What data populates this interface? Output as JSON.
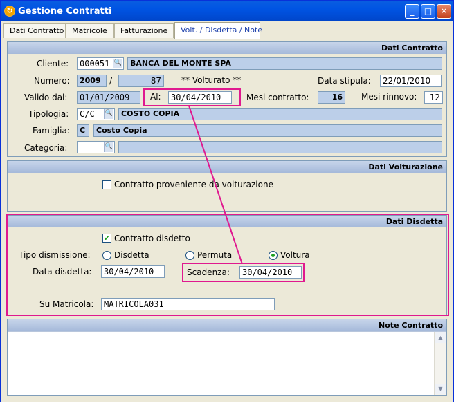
{
  "window": {
    "title": "Gestione Contratti",
    "minimize_glyph": "_",
    "maximize_glyph": "□",
    "close_glyph": "✕"
  },
  "tabs": [
    {
      "label": "Dati Contratto"
    },
    {
      "label": "Matricole"
    },
    {
      "label": "Fatturazione"
    },
    {
      "label": "Volt. / Disdetta / Note"
    }
  ],
  "dati_contratto": {
    "header": "Dati Contratto",
    "cliente_label": "Cliente:",
    "cliente_code": "000051",
    "cliente_name": "BANCA DEL MONTE SPA",
    "numero_label": "Numero:",
    "numero_year": "2009",
    "numero_sep": "/",
    "numero_num": "87",
    "volturato_text": "**  Volturato  **",
    "data_stipula_label": "Data stipula:",
    "data_stipula": "22/01/2010",
    "valido_dal_label": "Valido dal:",
    "valido_dal": "01/01/2009",
    "al_label": "Al:",
    "al_value": "30/04/2010",
    "mesi_contratto_label": "Mesi contratto:",
    "mesi_contratto": "16",
    "mesi_rinnovo_label": "Mesi rinnovo:",
    "mesi_rinnovo": "12",
    "tipologia_label": "Tipologia:",
    "tipologia_code": "C/C",
    "tipologia_desc": "COSTO COPIA",
    "famiglia_label": "Famiglia:",
    "famiglia_code": "C",
    "famiglia_desc": "Costo Copia",
    "categoria_label": "Categoria:",
    "categoria_code": "",
    "categoria_desc": ""
  },
  "dati_volturazione": {
    "header": "Dati Volturazione",
    "proveniente_label": "Contratto proveniente da volturazione",
    "proveniente_checked": false
  },
  "dati_disdetta": {
    "header": "Dati Disdetta",
    "disdetto_label": "Contratto disdetto",
    "disdetto_checked": true,
    "tipo_label": "Tipo dismissione:",
    "options": [
      "Disdetta",
      "Permuta",
      "Voltura"
    ],
    "selected": "Voltura",
    "data_disdetta_label": "Data disdetta:",
    "data_disdetta": "30/04/2010",
    "scadenza_label": "Scadenza:",
    "scadenza": "30/04/2010",
    "su_matricola_label": "Su Matricola:",
    "su_matricola": "MATRICOLA031"
  },
  "note_contratto": {
    "header": "Note Contratto",
    "text": ""
  },
  "icons": {
    "lookup": "search-icon",
    "check": "✔",
    "scroll_up": "▲",
    "scroll_down": "▼"
  },
  "colors": {
    "highlight": "#e0198f",
    "titlebar": "#0054e3"
  }
}
